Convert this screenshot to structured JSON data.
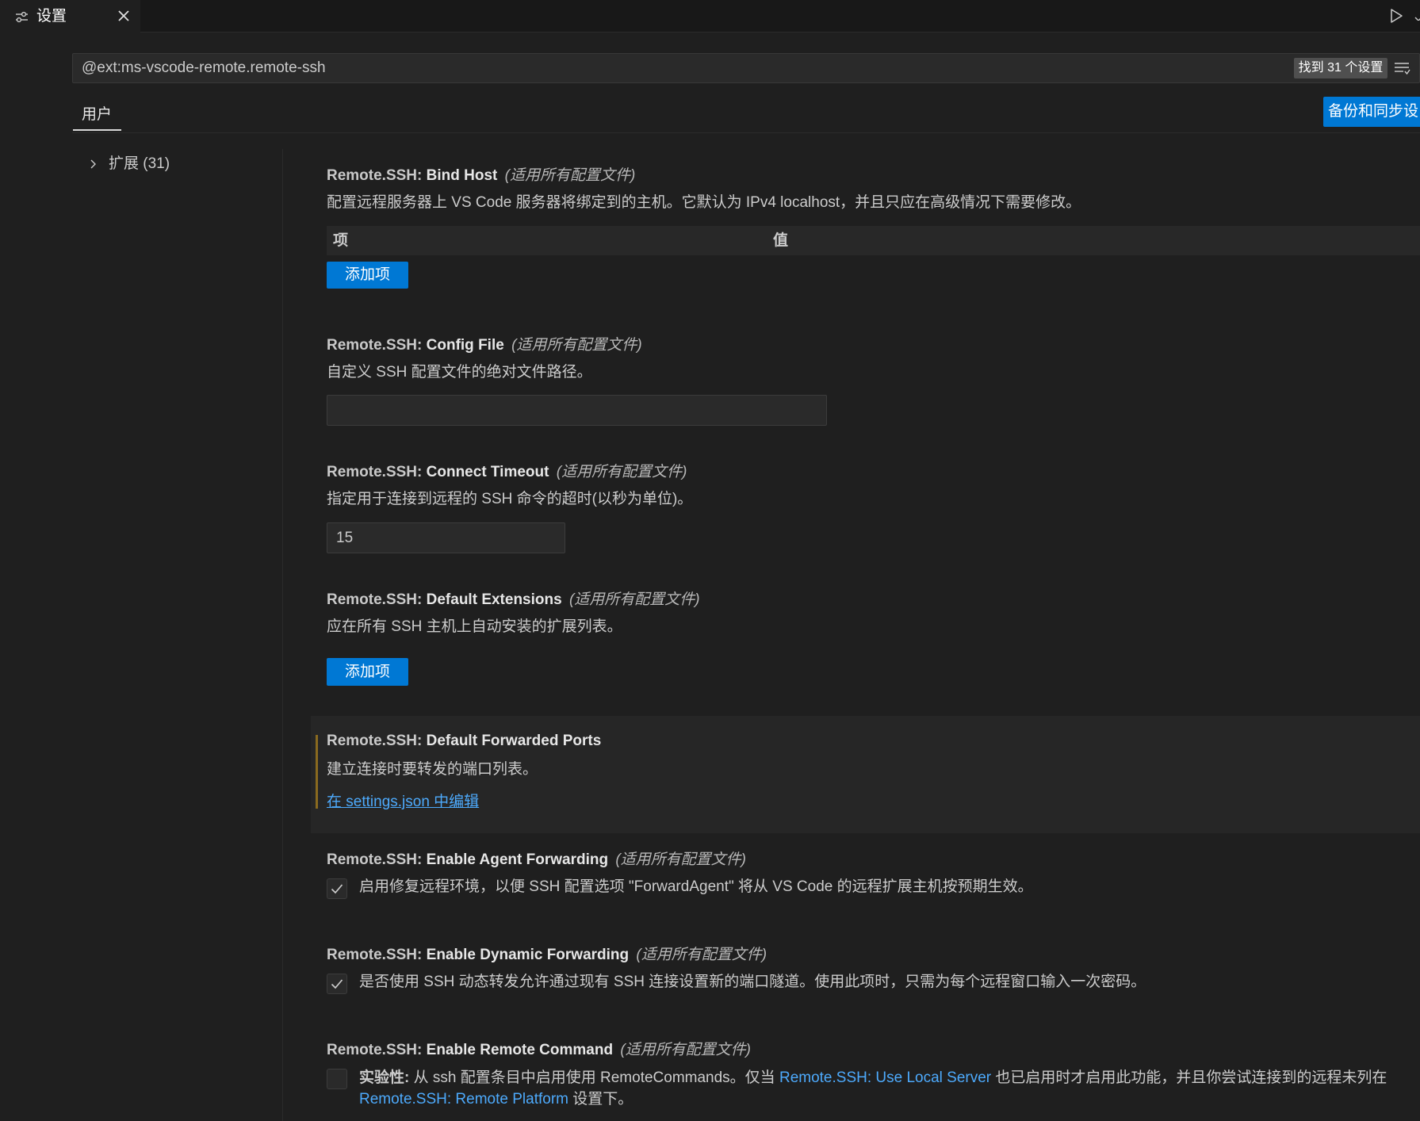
{
  "window": {
    "tab": {
      "label": "设置",
      "icon": "settings-sliders-icon",
      "close_icon": "close-icon"
    },
    "toolbar_icons": [
      "run-icon",
      "chevron-down-icon"
    ]
  },
  "search": {
    "value": "@ext:ms-vscode-remote.remote-ssh",
    "result_badge": "找到 31 个设置",
    "filter_icon": "filter-icon"
  },
  "scope_tabs": [
    {
      "label": "用户",
      "active": true
    }
  ],
  "backup_sync_button": {
    "label": "备份和同步设"
  },
  "toc": [
    {
      "label": "扩展 (31)",
      "expanded": false,
      "icon": "chevron-right-icon"
    }
  ],
  "settings": [
    {
      "category": "Remote.SSH:",
      "label": "Bind Host",
      "scope": "(适用所有配置文件)",
      "description": "配置远程服务器上 VS Code 服务器将绑定到的主机。它默认为 IPv4 localhost，并且只应在高级情况下需要修改。",
      "table_headers": [
        "项",
        "值"
      ],
      "button": "添加项"
    },
    {
      "category": "Remote.SSH:",
      "label": "Config File",
      "scope": "(适用所有配置文件)",
      "description": "自定义 SSH 配置文件的绝对文件路径。",
      "value": ""
    },
    {
      "category": "Remote.SSH:",
      "label": "Connect Timeout",
      "scope": "(适用所有配置文件)",
      "description": "指定用于连接到远程的 SSH 命令的超时(以秒为单位)。",
      "value": "15"
    },
    {
      "category": "Remote.SSH:",
      "label": "Default Extensions",
      "scope": "(适用所有配置文件)",
      "description": "应在所有 SSH 主机上自动安装的扩展列表。",
      "button": "添加项"
    },
    {
      "category": "Remote.SSH:",
      "label": "Default Forwarded Ports",
      "description": "建立连接时要转发的端口列表。",
      "link": "在 settings.json 中编辑",
      "modified": true,
      "focused": true
    },
    {
      "category": "Remote.SSH:",
      "label": "Enable Agent Forwarding",
      "scope": "(适用所有配置文件)",
      "checked": true,
      "description": "启用修复远程环境，以便 SSH 配置选项 \"ForwardAgent\" 将从 VS Code 的远程扩展主机按预期生效。"
    },
    {
      "category": "Remote.SSH:",
      "label": "Enable Dynamic Forwarding",
      "scope": "(适用所有配置文件)",
      "checked": true,
      "description": "是否使用 SSH 动态转发允许通过现有 SSH 连接设置新的端口隧道。使用此项时，只需为每个远程窗口输入一次密码。"
    },
    {
      "category": "Remote.SSH:",
      "label": "Enable Remote Command",
      "scope": "(适用所有配置文件)",
      "checked": false,
      "description_parts": [
        {
          "text": "实验性:",
          "bold": true
        },
        {
          "text": " 从 ssh 配置条目中启用使用 RemoteCommands。仅当 "
        },
        {
          "text": "Remote.SSH: Use Local Server",
          "link": true
        },
        {
          "text": " 也已启用时才启用此功能，并且你尝试连接到的远程未列在 "
        },
        {
          "text": "Remote.SSH: Remote Platform",
          "link": true
        },
        {
          "text": " 设置下。"
        }
      ]
    }
  ],
  "colors": {
    "background": "#1f1f1f",
    "text": "#cccccc",
    "accent": "#0078d4",
    "link": "#4daafc",
    "modified_indicator": "#8a6a1f"
  }
}
